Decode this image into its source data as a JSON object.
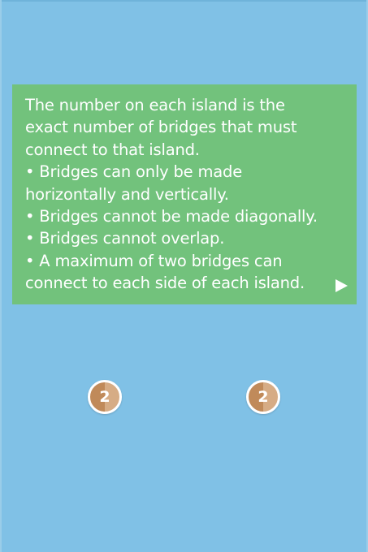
{
  "instructions": {
    "text": "The number on each island is the\nexact number of bridges that must\nconnect to that island.\n• Bridges can only be made\nhorizontally and vertically.\n• Bridges cannot be made diagonally.\n• Bridges cannot overlap.\n• A maximum of two bridges can\nconnect to each side of each island.",
    "next_icon": "play-triangle"
  },
  "board": {
    "islands": [
      {
        "label": "2",
        "required_bridges": 2
      },
      {
        "label": "2",
        "required_bridges": 2
      }
    ]
  },
  "colors": {
    "background": "#80c1e6",
    "panel": "#72c27c",
    "island_dark": "#c08a5a",
    "island_light": "#d6ac85",
    "text": "#ffffff"
  }
}
